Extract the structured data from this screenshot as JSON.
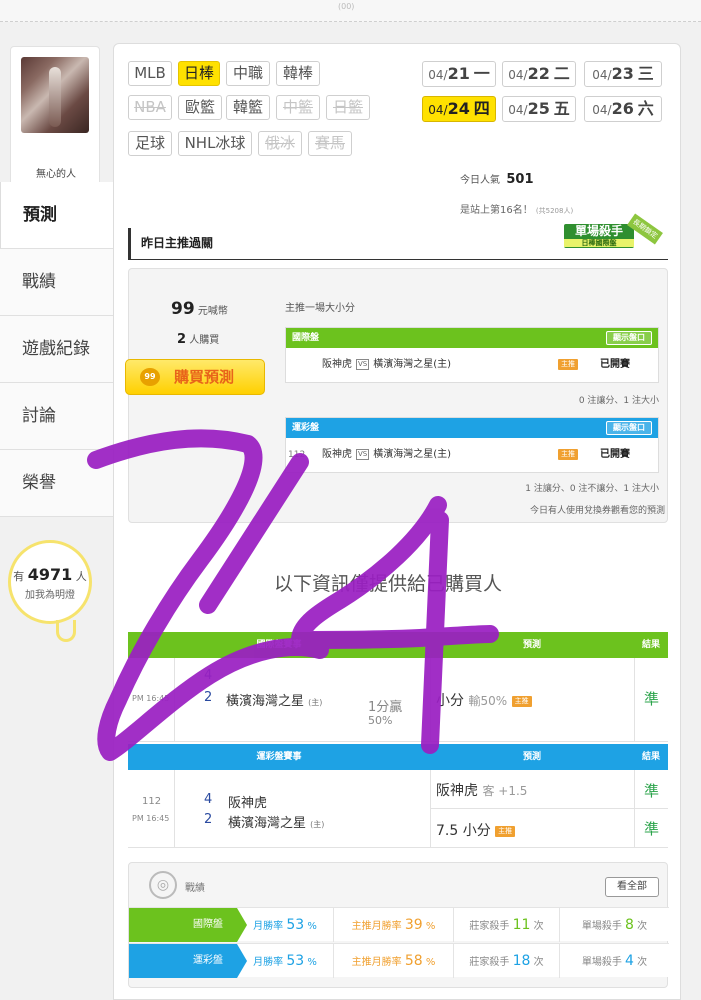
{
  "colors": {
    "accent_yellow": "#ffe100",
    "intl_green": "#6cc21e",
    "lottery_blue": "#1ea2e4",
    "correct_green": "#2aa34a",
    "scribble_purple": "#9a1fc2"
  },
  "top_small_text": "(00)",
  "user": {
    "nickname": "無心的人",
    "fans_prefix": "有",
    "fans_count": "4971",
    "fans_suffix": "人",
    "fans_line2": "加我為明燈"
  },
  "nav": [
    "預測",
    "戰績",
    "遊戲紀錄",
    "討論",
    "榮譽"
  ],
  "sports": {
    "row1": [
      "MLB",
      "日棒",
      "中職",
      "韓棒"
    ],
    "row2": [
      "NBA",
      "歐籃",
      "韓籃",
      "中籃",
      "日籃"
    ],
    "row3": [
      "足球",
      "NHL冰球",
      "俄冰",
      "賽馬"
    ]
  },
  "dates": [
    {
      "md": "04/",
      "d": "21",
      "w": "一"
    },
    {
      "md": "04/",
      "d": "22",
      "w": "二"
    },
    {
      "md": "04/",
      "d": "23",
      "w": "三"
    },
    {
      "md": "04/",
      "d": "24",
      "w": "四"
    },
    {
      "md": "04/",
      "d": "25",
      "w": "五"
    },
    {
      "md": "04/",
      "d": "26",
      "w": "六"
    }
  ],
  "popularity": {
    "label": "今日人氣",
    "value": "501"
  },
  "rank": {
    "text": "是站上第16名！",
    "suffix": "(共5208人)"
  },
  "ribbon": {
    "main": "單場殺手",
    "sub": "日棒國際盤",
    "tag": "長期鎖定"
  },
  "section_title": "昨日主推過關",
  "predict": {
    "price": "99",
    "price_unit": "元喊幣",
    "buyers": "2",
    "buyers_unit": "人購買",
    "buy_label": "購買預測",
    "coin": "99",
    "subtitle": "主推一場大小分",
    "intl": {
      "title": "國際盤",
      "show": "顯示盤口",
      "home_team": "阪神虎",
      "vs": "VS",
      "away_team": "橫濱海灣之星(主)",
      "push": "主推",
      "status": "已開賽"
    },
    "intl_stat": "0 注讓分、1 注大小",
    "lottery": {
      "title": "運彩盤",
      "show": "顯示盤口",
      "num": "112",
      "home_team": "阪神虎",
      "vs": "VS",
      "away_team": "橫濱海灣之星(主)",
      "push": "主推",
      "status": "已開賽"
    },
    "lottery_stat": "1 注讓分、0 注不讓分、1 注大小",
    "note": "今日有人使用兌換券觀看您的預測"
  },
  "info_text": "以下資訊僅提供給已購買人",
  "intl_table": {
    "headers": [
      "國際盤賽事",
      "預測",
      "結果"
    ],
    "time": "PM 16:45",
    "score1": "4",
    "score2": "2",
    "team2": "橫濱海灣之星",
    "home_mark": "(主)",
    "line1": "1分贏",
    "line2": "50%",
    "pred": "小分",
    "pred_note": "輸50%",
    "push": "主推",
    "result": "準"
  },
  "lottery_table": {
    "headers": [
      "運彩盤賽事",
      "預測",
      "結果"
    ],
    "num": "112",
    "time": "PM 16:45",
    "score1": "4",
    "team1": "阪神虎",
    "score2": "2",
    "team2": "橫濱海灣之星",
    "home_mark": "(主)",
    "pred1": "阪神虎",
    "pred1_note": "客 +1.5",
    "pred2": "7.5 小分",
    "push": "主推",
    "result1": "準",
    "result2": "準"
  },
  "record": {
    "title": "戰績",
    "view_all": "看全部",
    "rows": [
      {
        "label": "國際盤",
        "month_rate": "月勝率",
        "month_val": "53",
        "push_rate": "主推月勝率",
        "push_val": "39",
        "killer": "莊家殺手",
        "killer_val": "11",
        "single": "單場殺手",
        "single_val": "8",
        "unit_pct": "%",
        "unit_times": "次"
      },
      {
        "label": "運彩盤",
        "month_rate": "月勝率",
        "month_val": "53",
        "push_rate": "主推月勝率",
        "push_val": "58",
        "killer": "莊家殺手",
        "killer_val": "18",
        "single": "單場殺手",
        "single_val": "4",
        "unit_pct": "%",
        "unit_times": "次"
      }
    ]
  }
}
